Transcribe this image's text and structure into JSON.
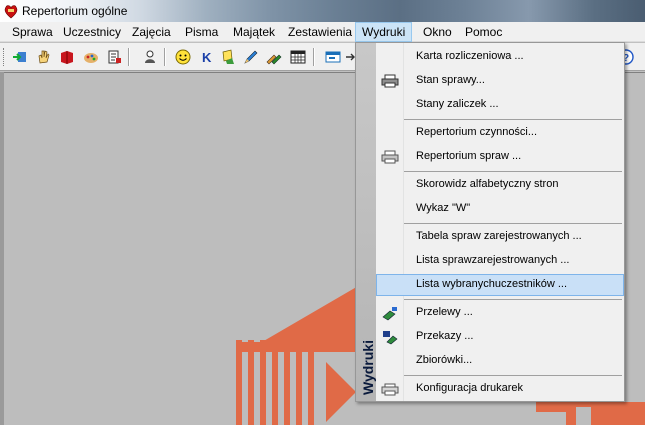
{
  "window": {
    "title": "Repertorium ogólne"
  },
  "menubar": [
    {
      "label": "Sprawa"
    },
    {
      "label": "Uczestnicy"
    },
    {
      "label": "Zajęcia"
    },
    {
      "label": "Pisma"
    },
    {
      "label": "Majątek"
    },
    {
      "label": "Zestawienia"
    },
    {
      "label": "Wydruki",
      "active": true
    },
    {
      "label": "Okno"
    },
    {
      "label": "Pomoc"
    }
  ],
  "toolbar": {
    "icons": [
      "login-icon",
      "hand-icon",
      "book-icon",
      "palette-icon",
      "document-icon",
      "person-icon",
      "smiley-icon",
      "k-icon",
      "notes-icon",
      "pencil-icon",
      "pencils-icon",
      "calendar-icon",
      "window-icon"
    ]
  },
  "dropdown": {
    "band_label": "Wydruki",
    "items": [
      {
        "label": "Karta rozliczeniowa ...",
        "icon": ""
      },
      {
        "label": "Stan sprawy...",
        "icon": "printer-icon"
      },
      {
        "label": "Stany zaliczek ...",
        "icon": ""
      },
      {
        "label": "Repertorium czynności...",
        "icon": ""
      },
      {
        "label": "Repertorium spraw ...",
        "icon": "printer-icon"
      },
      {
        "label": "Skorowidz alfabetyczny stron",
        "icon": ""
      },
      {
        "label": "Wykaz \"W\"",
        "icon": ""
      },
      {
        "label": "Tabela spraw zarejestrowanych ...",
        "icon": ""
      },
      {
        "label": "Lista sprawzarejestrowanych ...",
        "icon": ""
      },
      {
        "label": "Lista wybranychuczestników ...",
        "icon": "",
        "highlighted": true
      },
      {
        "label": "Przelewy ...",
        "icon": "transfer-icon"
      },
      {
        "label": "Przekazy ...",
        "icon": "money-order-icon"
      },
      {
        "label": "Zbiorówki...",
        "icon": ""
      },
      {
        "label": "Konfiguracja drukarek",
        "icon": "printer-icon"
      }
    ]
  }
}
